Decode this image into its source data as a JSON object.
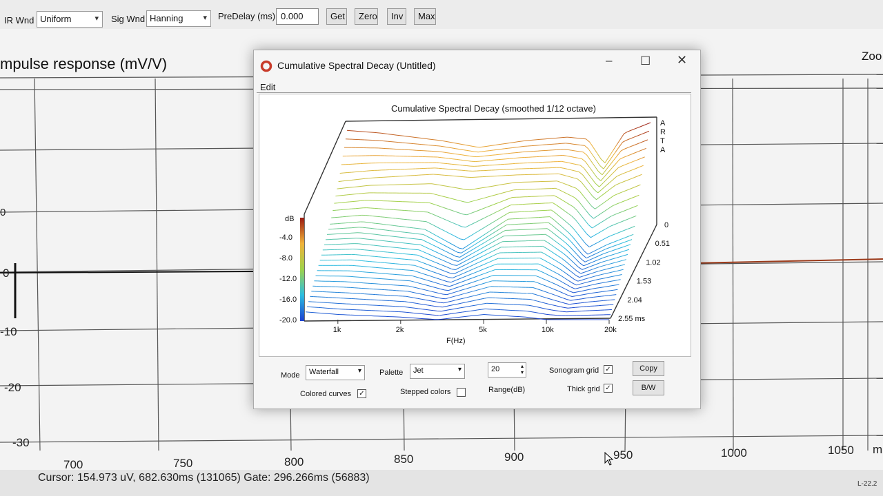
{
  "toolbar": {
    "ir_wnd_label": "IR Wnd",
    "ir_wnd_value": "Uniform",
    "sig_wnd_label": "Sig Wnd",
    "sig_wnd_value": "Hanning",
    "predelay_label": "PreDelay (ms)",
    "predelay_value": "0.000",
    "buttons": [
      "Get",
      "Zero",
      "Inv",
      "Max"
    ]
  },
  "background_plot": {
    "title": "mpulse response (mV/V)",
    "zoom_label": "Zoo",
    "y_ticks": [
      "0",
      "0",
      "-10",
      "-20",
      "-30"
    ],
    "x_ticks": [
      "700",
      "750",
      "800",
      "850",
      "900",
      "950",
      "1000",
      "1050",
      "m"
    ]
  },
  "status": {
    "cursor_text": "Cursor: 154.973 uV, 682.630ms (131065)  Gate: 296.266ms (56883)",
    "right_text": "L-22.2"
  },
  "dialog": {
    "title": "Cumulative Spectral Decay  (Untitled)",
    "menu": [
      "Edit"
    ],
    "controls": {
      "mode_label": "Mode",
      "mode_value": "Waterfall",
      "palette_label": "Palette",
      "palette_value": "Jet",
      "range_value": "20",
      "range_label": "Range(dB)",
      "colored_curves_label": "Colored curves",
      "colored_curves_checked": true,
      "stepped_colors_label": "Stepped colors",
      "stepped_colors_checked": false,
      "sonogram_grid_label": "Sonogram grid",
      "sonogram_grid_checked": true,
      "thick_grid_label": "Thick grid",
      "thick_grid_checked": true,
      "copy_label": "Copy",
      "bw_label": "B/W"
    }
  },
  "chart_data": {
    "type": "waterfall",
    "title": "Cumulative Spectral Decay (smoothed 1/12 octave)",
    "xlabel": "F(Hz)",
    "ylabel": "dB",
    "zlabel": "ms",
    "x_tick_labels": [
      "1k",
      "2k",
      "5k",
      "10k",
      "20k"
    ],
    "x_tick_values": [
      1000,
      2000,
      5000,
      10000,
      20000
    ],
    "y_tick_labels": [
      "-4.0",
      "-8.0",
      "-12.0",
      "-16.0",
      "-20.0"
    ],
    "z_tick_labels": [
      "0",
      "0.51",
      "1.02",
      "1.53",
      "2.04",
      "2.55 ms"
    ],
    "brand_letters": [
      "A",
      "R",
      "T",
      "A"
    ],
    "ylim": [
      -20,
      0
    ],
    "xlim_hz": [
      700,
      20000
    ],
    "palette": "Jet",
    "num_slices": 30,
    "time_max_ms": 2.55,
    "series": [
      {
        "time_ms": 0,
        "freq_hz": [
          700,
          1000,
          2000,
          3000,
          5000,
          8000,
          10000,
          12000,
          15000,
          20000
        ],
        "db": [
          -1.5,
          -2.0,
          -3.5,
          -4.8,
          -3.5,
          -2.8,
          -3.2,
          -8.0,
          -2.0,
          0.0
        ]
      },
      {
        "time_ms": 0.51,
        "freq_hz": [
          700,
          1000,
          2000,
          3000,
          5000,
          8000,
          10000,
          12000,
          15000,
          20000
        ],
        "db": [
          -7.5,
          -6.8,
          -6.0,
          -6.5,
          -6.2,
          -6.0,
          -7.0,
          -11.0,
          -8.0,
          -6.0
        ]
      },
      {
        "time_ms": 1.02,
        "freq_hz": [
          700,
          1000,
          2000,
          3000,
          5000,
          8000,
          10000,
          12000,
          15000,
          20000
        ],
        "db": [
          -12.0,
          -11.5,
          -13.0,
          -17.0,
          -11.0,
          -10.5,
          -14.0,
          -18.0,
          -16.0,
          -14.0
        ]
      },
      {
        "time_ms": 2.55,
        "freq_hz": [
          700,
          1000,
          2000,
          3000,
          5000,
          8000,
          10000,
          12000,
          15000,
          20000
        ],
        "db": [
          -18.5,
          -19.0,
          -19.5,
          -20.0,
          -19.0,
          -19.5,
          -20.0,
          -20.0,
          -20.0,
          -20.0
        ]
      }
    ]
  }
}
